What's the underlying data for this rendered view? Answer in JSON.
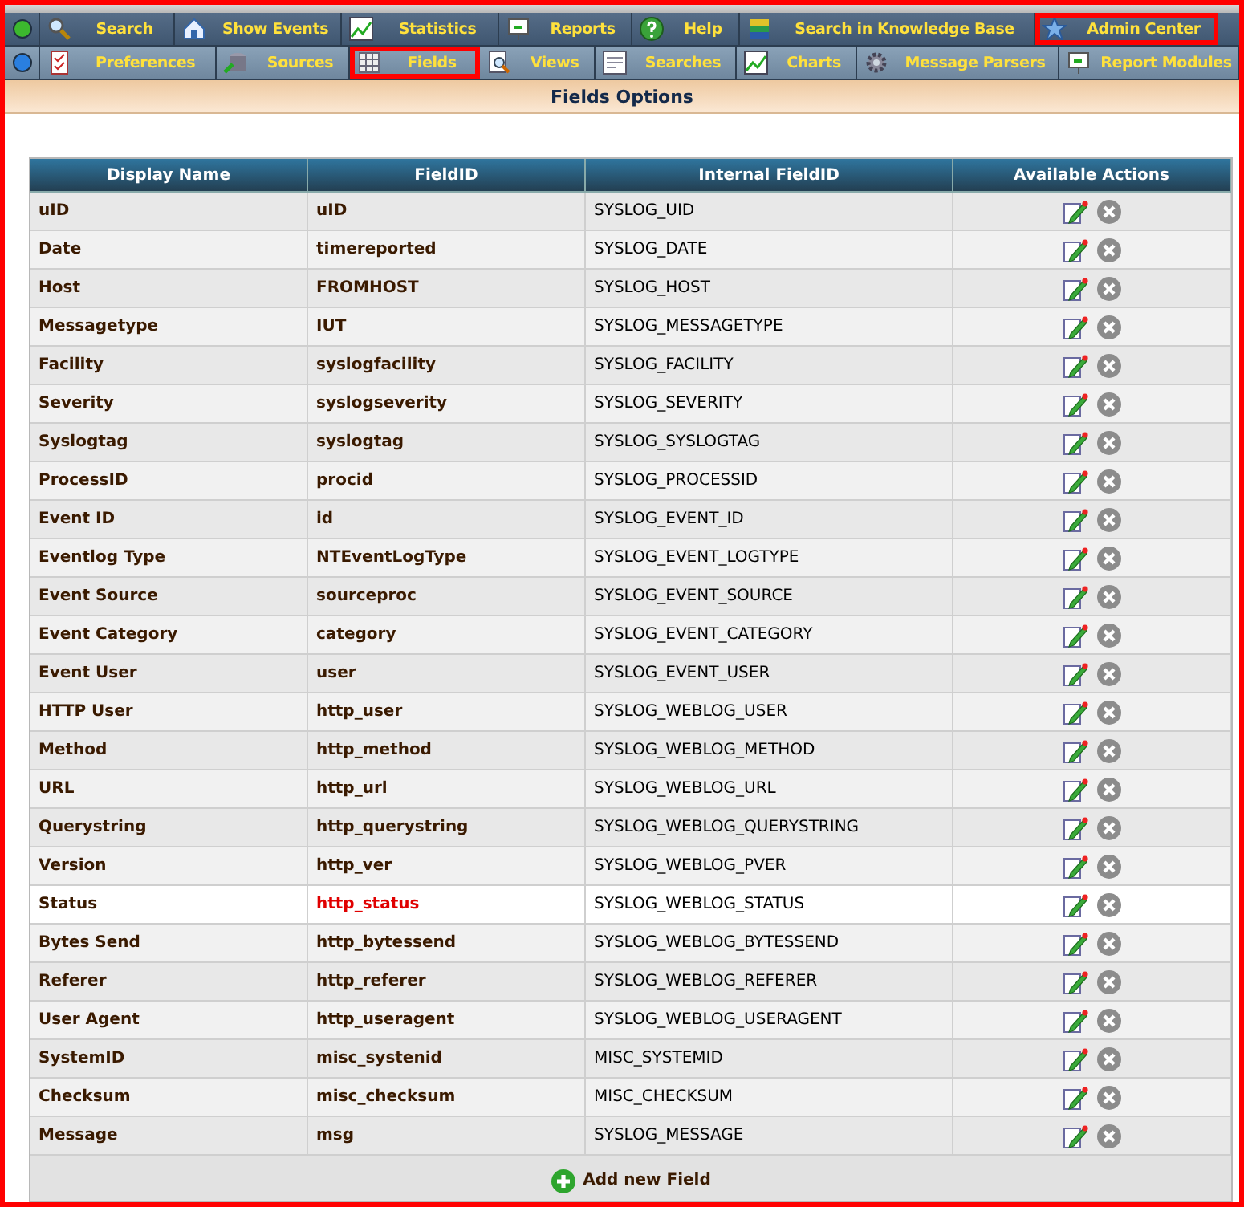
{
  "menu_rows": [
    {
      "color": "#3cb82e",
      "items": [
        {
          "label": "Search",
          "highlighted": false
        },
        {
          "label": "Show Events",
          "highlighted": false
        },
        {
          "label": "Statistics",
          "highlighted": false
        },
        {
          "label": "Reports",
          "highlighted": false
        },
        {
          "label": "Help",
          "highlighted": false
        },
        {
          "label": "Search in Knowledge Base",
          "highlighted": false
        },
        {
          "label": "Admin Center",
          "highlighted": true
        }
      ]
    },
    {
      "color": "#2a7fe0",
      "items": [
        {
          "label": "Preferences",
          "highlighted": false
        },
        {
          "label": "Sources",
          "highlighted": false
        },
        {
          "label": "Fields",
          "highlighted": true
        },
        {
          "label": "Views",
          "highlighted": false
        },
        {
          "label": "Searches",
          "highlighted": false
        },
        {
          "label": "Charts",
          "highlighted": false
        },
        {
          "label": "Message Parsers",
          "highlighted": false
        },
        {
          "label": "Report Modules",
          "highlighted": false
        }
      ]
    }
  ],
  "section_title": "Fields Options",
  "table": {
    "columns": [
      "Display Name",
      "FieldID",
      "Internal FieldID",
      "Available Actions"
    ],
    "rows": [
      {
        "display_name": "uID",
        "field_id": "uID",
        "internal_field_id": "SYSLOG_UID",
        "highlighted": false
      },
      {
        "display_name": "Date",
        "field_id": "timereported",
        "internal_field_id": "SYSLOG_DATE",
        "highlighted": false
      },
      {
        "display_name": "Host",
        "field_id": "FROMHOST",
        "internal_field_id": "SYSLOG_HOST",
        "highlighted": false
      },
      {
        "display_name": "Messagetype",
        "field_id": "IUT",
        "internal_field_id": "SYSLOG_MESSAGETYPE",
        "highlighted": false
      },
      {
        "display_name": "Facility",
        "field_id": "syslogfacility",
        "internal_field_id": "SYSLOG_FACILITY",
        "highlighted": false
      },
      {
        "display_name": "Severity",
        "field_id": "syslogseverity",
        "internal_field_id": "SYSLOG_SEVERITY",
        "highlighted": false
      },
      {
        "display_name": "Syslogtag",
        "field_id": "syslogtag",
        "internal_field_id": "SYSLOG_SYSLOGTAG",
        "highlighted": false
      },
      {
        "display_name": "ProcessID",
        "field_id": "procid",
        "internal_field_id": "SYSLOG_PROCESSID",
        "highlighted": false
      },
      {
        "display_name": "Event ID",
        "field_id": "id",
        "internal_field_id": "SYSLOG_EVENT_ID",
        "highlighted": false
      },
      {
        "display_name": "Eventlog Type",
        "field_id": "NTEventLogType",
        "internal_field_id": "SYSLOG_EVENT_LOGTYPE",
        "highlighted": false
      },
      {
        "display_name": "Event Source",
        "field_id": "sourceproc",
        "internal_field_id": "SYSLOG_EVENT_SOURCE",
        "highlighted": false
      },
      {
        "display_name": "Event Category",
        "field_id": "category",
        "internal_field_id": "SYSLOG_EVENT_CATEGORY",
        "highlighted": false
      },
      {
        "display_name": "Event User",
        "field_id": "user",
        "internal_field_id": "SYSLOG_EVENT_USER",
        "highlighted": false
      },
      {
        "display_name": "HTTP User",
        "field_id": "http_user",
        "internal_field_id": "SYSLOG_WEBLOG_USER",
        "highlighted": false
      },
      {
        "display_name": "Method",
        "field_id": "http_method",
        "internal_field_id": "SYSLOG_WEBLOG_METHOD",
        "highlighted": false
      },
      {
        "display_name": "URL",
        "field_id": "http_url",
        "internal_field_id": "SYSLOG_WEBLOG_URL",
        "highlighted": false
      },
      {
        "display_name": "Querystring",
        "field_id": "http_querystring",
        "internal_field_id": "SYSLOG_WEBLOG_QUERYSTRING",
        "highlighted": false
      },
      {
        "display_name": "Version",
        "field_id": "http_ver",
        "internal_field_id": "SYSLOG_WEBLOG_PVER",
        "highlighted": false
      },
      {
        "display_name": "Status",
        "field_id": "http_status",
        "internal_field_id": "SYSLOG_WEBLOG_STATUS",
        "highlighted": true
      },
      {
        "display_name": "Bytes Send",
        "field_id": "http_bytessend",
        "internal_field_id": "SYSLOG_WEBLOG_BYTESSEND",
        "highlighted": false
      },
      {
        "display_name": "Referer",
        "field_id": "http_referer",
        "internal_field_id": "SYSLOG_WEBLOG_REFERER",
        "highlighted": false
      },
      {
        "display_name": "User Agent",
        "field_id": "http_useragent",
        "internal_field_id": "SYSLOG_WEBLOG_USERAGENT",
        "highlighted": false
      },
      {
        "display_name": "SystemID",
        "field_id": "misc_systenid",
        "internal_field_id": "MISC_SYSTEMID",
        "highlighted": false
      },
      {
        "display_name": "Checksum",
        "field_id": "misc_checksum",
        "internal_field_id": "MISC_CHECKSUM",
        "highlighted": false
      },
      {
        "display_name": "Message",
        "field_id": "msg",
        "internal_field_id": "SYSLOG_MESSAGE",
        "highlighted": false
      }
    ]
  },
  "add_button": "Add new Field"
}
